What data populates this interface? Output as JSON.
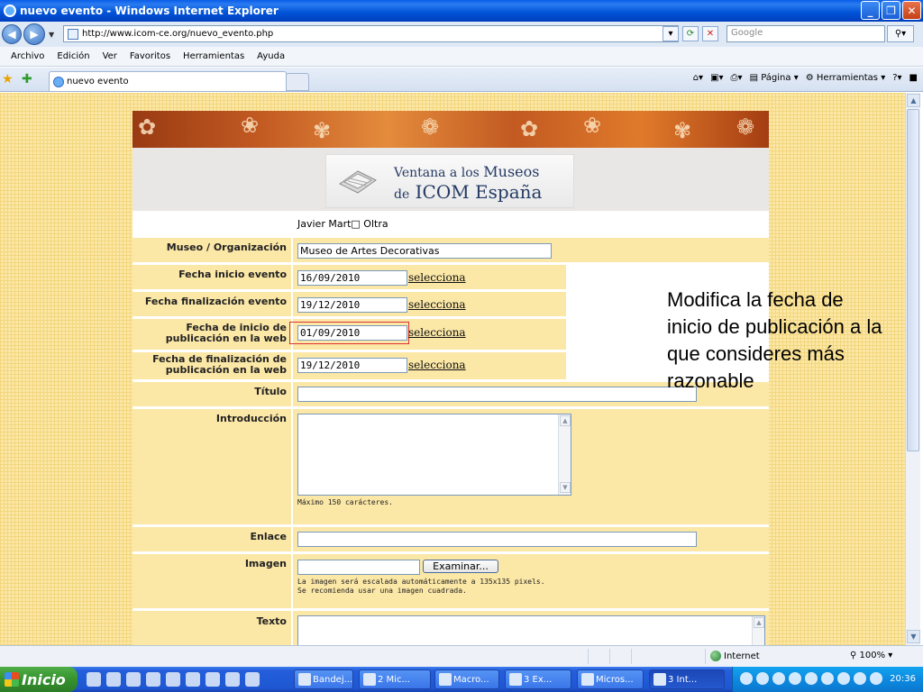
{
  "window": {
    "title": "nuevo evento - Windows Internet Explorer"
  },
  "address": {
    "url": "http://www.icom-ce.org/nuevo_evento.php",
    "search_placeholder": "Google"
  },
  "menu": [
    "Archivo",
    "Edición",
    "Ver",
    "Favoritos",
    "Herramientas",
    "Ayuda"
  ],
  "tab": {
    "label": "nuevo evento"
  },
  "commandbar": {
    "page": "Página",
    "tools": "Herramientas"
  },
  "logo": {
    "line1": "Ventana a los",
    "line1b": "Museos",
    "line2a": "de",
    "line2b": "ICOM España"
  },
  "form": {
    "user": "Javier Mart□ Oltra",
    "museo_label": "Museo / Organización",
    "museo_value": "Museo de Artes Decorativas",
    "inicio_label": "Fecha inicio evento",
    "inicio_value": "16/09/2010",
    "fin_label": "Fecha finalización evento",
    "fin_value": "19/12/2010",
    "pubini_label1": "Fecha de inicio de",
    "pubini_label2": "publicación en la web",
    "pubini_value": "01/09/2010",
    "pubfin_label1": "Fecha de finalización de",
    "pubfin_label2": "publicación en la web",
    "pubfin_value": "19/12/2010",
    "selecciona": "selecciona",
    "titulo_label": "Título",
    "intro_label": "Introducción",
    "intro_hint": "Máximo 150 carácteres.",
    "enlace_label": "Enlace",
    "imagen_label": "Imagen",
    "examinar": "Examinar...",
    "imagen_hint1": "La imagen será escalada automáticamente a 135x135 pixels.",
    "imagen_hint2": "Se recomienda usar una imagen cuadrada.",
    "texto_label": "Texto"
  },
  "callout": "Modifica la fecha de inicio de publicación a la que consideres más razonable",
  "status": {
    "zone": "Internet",
    "zoom": "100%"
  },
  "taskbar": {
    "start": "Inicio",
    "tasks": [
      "Bandej...",
      "2 Mic...",
      "Macro...",
      "3 Ex...",
      "Micros...",
      "3 Int..."
    ],
    "time": "20:36"
  }
}
